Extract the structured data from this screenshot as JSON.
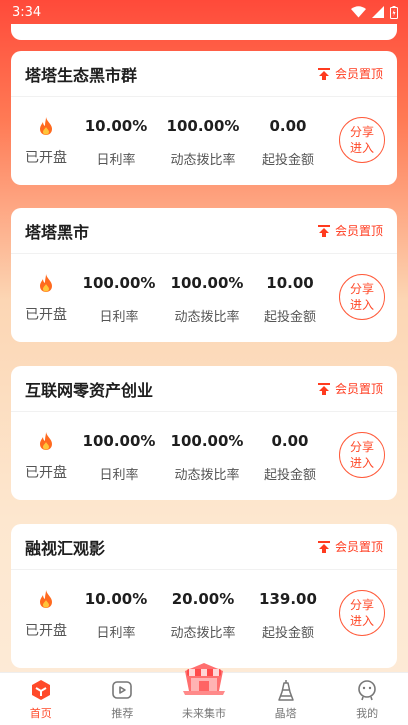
{
  "status_bar": {
    "time": "3:34"
  },
  "cards": [
    {
      "title": "塔塔生态黑市群",
      "vip_label": "会员置顶",
      "status": "已开盘",
      "daily_rate": "10.00%",
      "daily_rate_label": "日利率",
      "dynamic_ratio": "100.00%",
      "dynamic_ratio_label": "动态拨比率",
      "min_amount": "0.00",
      "min_amount_label": "起投金额",
      "share_line1": "分享",
      "share_line2": "进入"
    },
    {
      "title": "塔塔黑市",
      "vip_label": "会员置顶",
      "status": "已开盘",
      "daily_rate": "100.00%",
      "daily_rate_label": "日利率",
      "dynamic_ratio": "100.00%",
      "dynamic_ratio_label": "动态拨比率",
      "min_amount": "10.00",
      "min_amount_label": "起投金额",
      "share_line1": "分享",
      "share_line2": "进入"
    },
    {
      "title": "互联网零资产创业",
      "vip_label": "会员置顶",
      "status": "已开盘",
      "daily_rate": "100.00%",
      "daily_rate_label": "日利率",
      "dynamic_ratio": "100.00%",
      "dynamic_ratio_label": "动态拨比率",
      "min_amount": "0.00",
      "min_amount_label": "起投金额",
      "share_line1": "分享",
      "share_line2": "进入"
    },
    {
      "title": "融视汇观影",
      "vip_label": "会员置顶",
      "status": "已开盘",
      "daily_rate": "10.00%",
      "daily_rate_label": "日利率",
      "dynamic_ratio": "20.00%",
      "dynamic_ratio_label": "动态拨比率",
      "min_amount": "139.00",
      "min_amount_label": "起投金额",
      "share_line1": "分享",
      "share_line2": "进入"
    }
  ],
  "nav": {
    "home": "首页",
    "recommend": "推荐",
    "market": "未来集市",
    "tower": "晶塔",
    "mine": "我的"
  },
  "colors": {
    "accent": "#ff4a2a",
    "header_top": "#ff4a3a"
  }
}
